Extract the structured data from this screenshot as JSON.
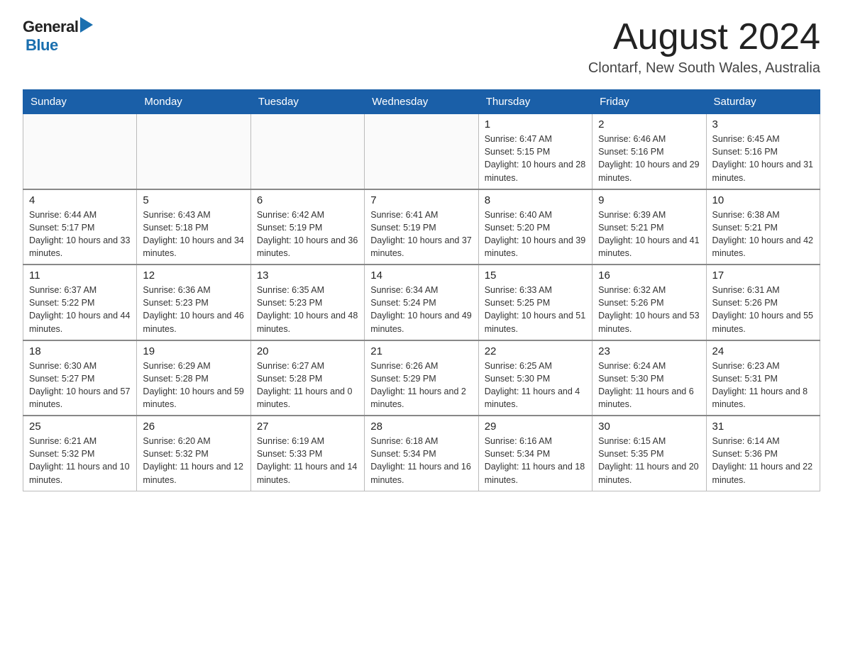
{
  "header": {
    "logo_general": "General",
    "logo_blue": "Blue",
    "month_title": "August 2024",
    "location": "Clontarf, New South Wales, Australia"
  },
  "days_of_week": [
    "Sunday",
    "Monday",
    "Tuesday",
    "Wednesday",
    "Thursday",
    "Friday",
    "Saturday"
  ],
  "weeks": [
    {
      "days": [
        {
          "number": "",
          "info": ""
        },
        {
          "number": "",
          "info": ""
        },
        {
          "number": "",
          "info": ""
        },
        {
          "number": "",
          "info": ""
        },
        {
          "number": "1",
          "info": "Sunrise: 6:47 AM\nSunset: 5:15 PM\nDaylight: 10 hours and 28 minutes."
        },
        {
          "number": "2",
          "info": "Sunrise: 6:46 AM\nSunset: 5:16 PM\nDaylight: 10 hours and 29 minutes."
        },
        {
          "number": "3",
          "info": "Sunrise: 6:45 AM\nSunset: 5:16 PM\nDaylight: 10 hours and 31 minutes."
        }
      ]
    },
    {
      "days": [
        {
          "number": "4",
          "info": "Sunrise: 6:44 AM\nSunset: 5:17 PM\nDaylight: 10 hours and 33 minutes."
        },
        {
          "number": "5",
          "info": "Sunrise: 6:43 AM\nSunset: 5:18 PM\nDaylight: 10 hours and 34 minutes."
        },
        {
          "number": "6",
          "info": "Sunrise: 6:42 AM\nSunset: 5:19 PM\nDaylight: 10 hours and 36 minutes."
        },
        {
          "number": "7",
          "info": "Sunrise: 6:41 AM\nSunset: 5:19 PM\nDaylight: 10 hours and 37 minutes."
        },
        {
          "number": "8",
          "info": "Sunrise: 6:40 AM\nSunset: 5:20 PM\nDaylight: 10 hours and 39 minutes."
        },
        {
          "number": "9",
          "info": "Sunrise: 6:39 AM\nSunset: 5:21 PM\nDaylight: 10 hours and 41 minutes."
        },
        {
          "number": "10",
          "info": "Sunrise: 6:38 AM\nSunset: 5:21 PM\nDaylight: 10 hours and 42 minutes."
        }
      ]
    },
    {
      "days": [
        {
          "number": "11",
          "info": "Sunrise: 6:37 AM\nSunset: 5:22 PM\nDaylight: 10 hours and 44 minutes."
        },
        {
          "number": "12",
          "info": "Sunrise: 6:36 AM\nSunset: 5:23 PM\nDaylight: 10 hours and 46 minutes."
        },
        {
          "number": "13",
          "info": "Sunrise: 6:35 AM\nSunset: 5:23 PM\nDaylight: 10 hours and 48 minutes."
        },
        {
          "number": "14",
          "info": "Sunrise: 6:34 AM\nSunset: 5:24 PM\nDaylight: 10 hours and 49 minutes."
        },
        {
          "number": "15",
          "info": "Sunrise: 6:33 AM\nSunset: 5:25 PM\nDaylight: 10 hours and 51 minutes."
        },
        {
          "number": "16",
          "info": "Sunrise: 6:32 AM\nSunset: 5:26 PM\nDaylight: 10 hours and 53 minutes."
        },
        {
          "number": "17",
          "info": "Sunrise: 6:31 AM\nSunset: 5:26 PM\nDaylight: 10 hours and 55 minutes."
        }
      ]
    },
    {
      "days": [
        {
          "number": "18",
          "info": "Sunrise: 6:30 AM\nSunset: 5:27 PM\nDaylight: 10 hours and 57 minutes."
        },
        {
          "number": "19",
          "info": "Sunrise: 6:29 AM\nSunset: 5:28 PM\nDaylight: 10 hours and 59 minutes."
        },
        {
          "number": "20",
          "info": "Sunrise: 6:27 AM\nSunset: 5:28 PM\nDaylight: 11 hours and 0 minutes."
        },
        {
          "number": "21",
          "info": "Sunrise: 6:26 AM\nSunset: 5:29 PM\nDaylight: 11 hours and 2 minutes."
        },
        {
          "number": "22",
          "info": "Sunrise: 6:25 AM\nSunset: 5:30 PM\nDaylight: 11 hours and 4 minutes."
        },
        {
          "number": "23",
          "info": "Sunrise: 6:24 AM\nSunset: 5:30 PM\nDaylight: 11 hours and 6 minutes."
        },
        {
          "number": "24",
          "info": "Sunrise: 6:23 AM\nSunset: 5:31 PM\nDaylight: 11 hours and 8 minutes."
        }
      ]
    },
    {
      "days": [
        {
          "number": "25",
          "info": "Sunrise: 6:21 AM\nSunset: 5:32 PM\nDaylight: 11 hours and 10 minutes."
        },
        {
          "number": "26",
          "info": "Sunrise: 6:20 AM\nSunset: 5:32 PM\nDaylight: 11 hours and 12 minutes."
        },
        {
          "number": "27",
          "info": "Sunrise: 6:19 AM\nSunset: 5:33 PM\nDaylight: 11 hours and 14 minutes."
        },
        {
          "number": "28",
          "info": "Sunrise: 6:18 AM\nSunset: 5:34 PM\nDaylight: 11 hours and 16 minutes."
        },
        {
          "number": "29",
          "info": "Sunrise: 6:16 AM\nSunset: 5:34 PM\nDaylight: 11 hours and 18 minutes."
        },
        {
          "number": "30",
          "info": "Sunrise: 6:15 AM\nSunset: 5:35 PM\nDaylight: 11 hours and 20 minutes."
        },
        {
          "number": "31",
          "info": "Sunrise: 6:14 AM\nSunset: 5:36 PM\nDaylight: 11 hours and 22 minutes."
        }
      ]
    }
  ]
}
